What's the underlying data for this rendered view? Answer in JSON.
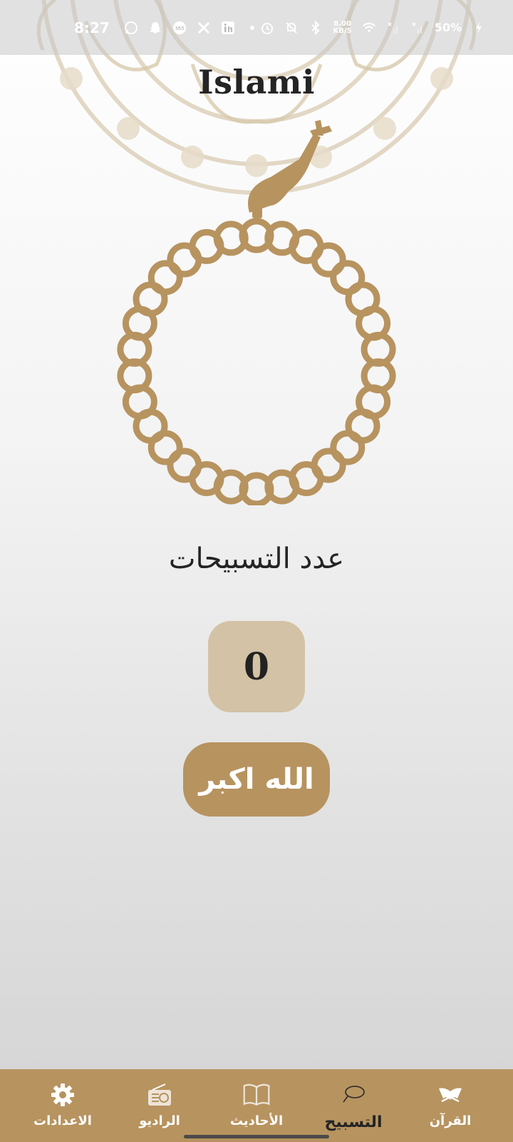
{
  "status_bar": {
    "time": "8:27",
    "network_speed_value": "8.00",
    "network_speed_unit": "KB/S",
    "battery": "50%",
    "icons": [
      "whatsapp-icon",
      "snapchat-icon",
      "365-icon",
      "x-icon",
      "linkedin-icon",
      "dot-icon",
      "alarm-icon",
      "mute-icon",
      "bluetooth-icon",
      "wifi-icon",
      "signal-icon",
      "charging-icon"
    ]
  },
  "app": {
    "title": "Islami"
  },
  "tasbeeh": {
    "count_label": "عدد التسبيحات",
    "count_value": "0",
    "dhikr_label": "الله اكبر"
  },
  "bottom_nav": {
    "items": [
      {
        "label": "القرآن",
        "icon": "quran-icon",
        "active": false
      },
      {
        "label": "التسبيح",
        "icon": "sebha-icon",
        "active": true
      },
      {
        "label": "الأحاديث",
        "icon": "book-icon",
        "active": false
      },
      {
        "label": "الراديو",
        "icon": "radio-icon",
        "active": false
      },
      {
        "label": "الاعدادات",
        "icon": "settings-icon",
        "active": false
      }
    ]
  },
  "colors": {
    "accent": "#b7935f",
    "counter_bg": "#d4c2a6",
    "text_dark": "#242424"
  }
}
